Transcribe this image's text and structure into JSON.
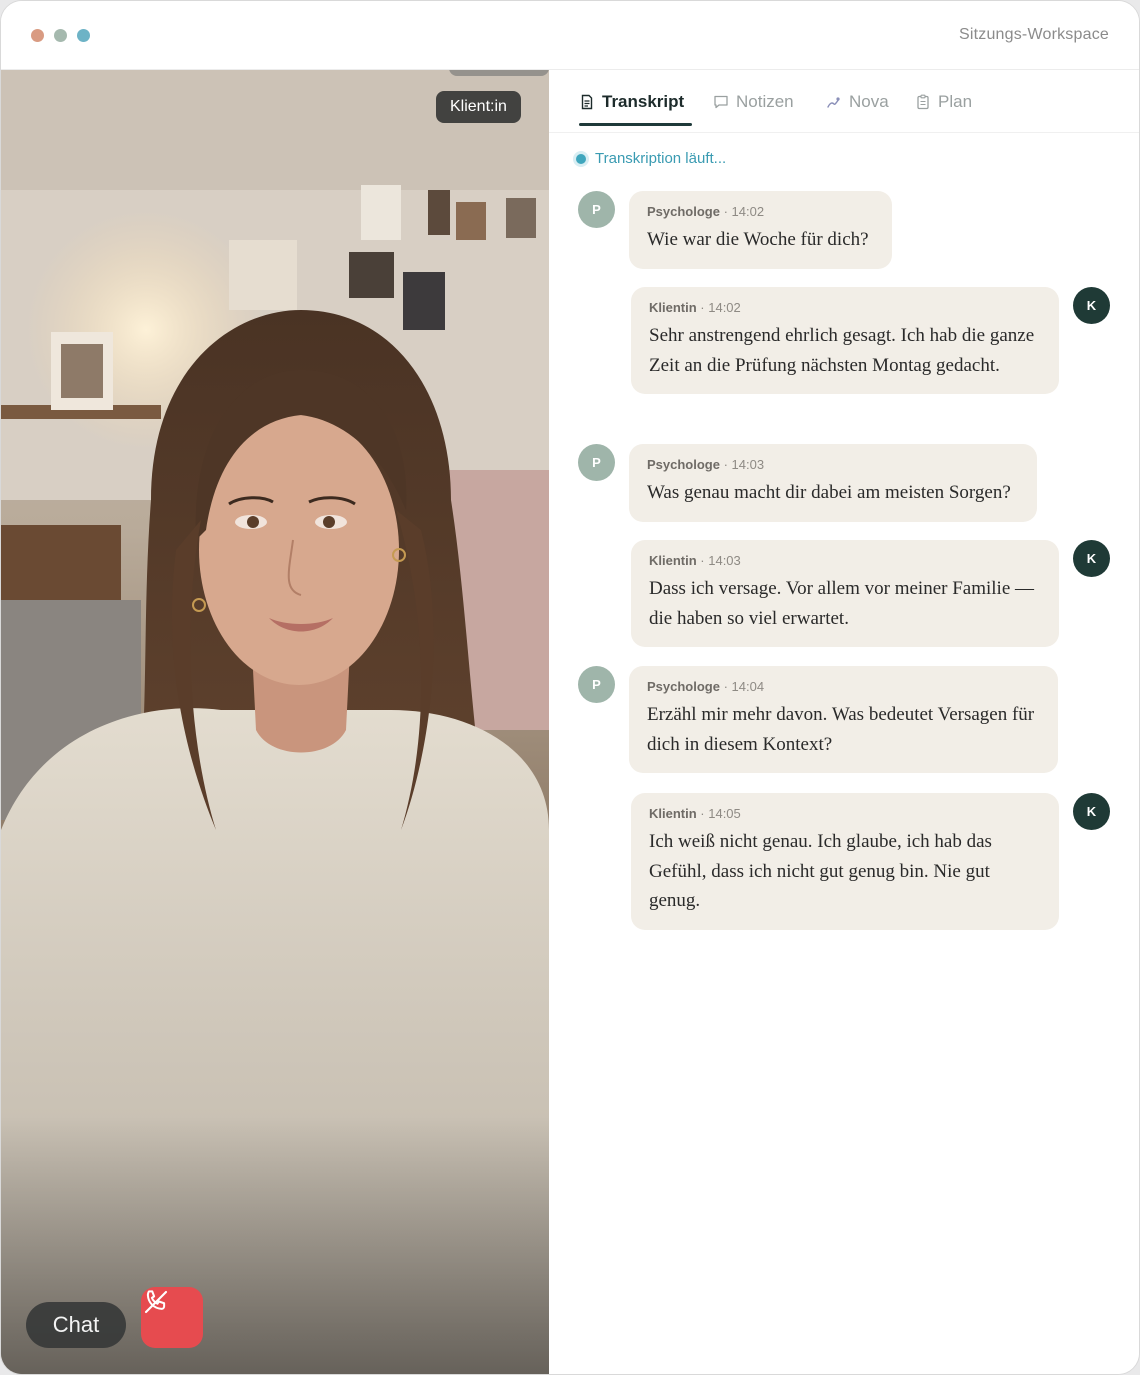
{
  "window": {
    "title": "Sitzungs-Workspace",
    "traffic_light_colors": [
      "#d99b82",
      "#a5b9ae",
      "#6db3c6"
    ]
  },
  "video": {
    "speaker_label": "Klient:in",
    "chat_label": "Chat",
    "hangup_icon": "phone-off-icon"
  },
  "tabs": [
    {
      "label": "Transkript",
      "icon": "document-icon",
      "active": true
    },
    {
      "label": "Notizen",
      "icon": "chat-bubble-icon",
      "active": false
    },
    {
      "label": "Nova",
      "icon": "sparkle-pen-icon",
      "active": false
    },
    {
      "label": "Plan",
      "icon": "clipboard-icon",
      "active": false
    }
  ],
  "status": {
    "text": "Transkription läuft..."
  },
  "messages": [
    {
      "initial": "P",
      "speaker": "Psychologe",
      "time": "· 14:02",
      "text": "Wie war die Woche für dich?"
    },
    {
      "initial": "K",
      "speaker": "Klientin",
      "time": "· 14:02",
      "text": "Sehr anstrengend ehrlich gesagt. Ich hab die ganze Zeit an die Prüfung nächsten Montag gedacht."
    },
    {
      "initial": "P",
      "speaker": "Psychologe",
      "time": "· 14:03",
      "text": "Was genau macht dir dabei am meisten Sorgen?"
    },
    {
      "initial": "K",
      "speaker": "Klientin",
      "time": "· 14:03",
      "text": "Dass ich versage. Vor allem vor meiner Familie — die haben so viel erwartet."
    },
    {
      "initial": "P",
      "speaker": "Psychologe",
      "time": "· 14:04",
      "text": "Erzähl mir mehr davon. Was bedeutet Versagen für dich in diesem Kontext?"
    },
    {
      "initial": "K",
      "speaker": "Klientin",
      "time": "· 14:05",
      "text": "Ich weiß nicht genau. Ich glaube, ich hab das Gefühl, dass ich nicht gut genug bin. Nie gut genug."
    }
  ]
}
